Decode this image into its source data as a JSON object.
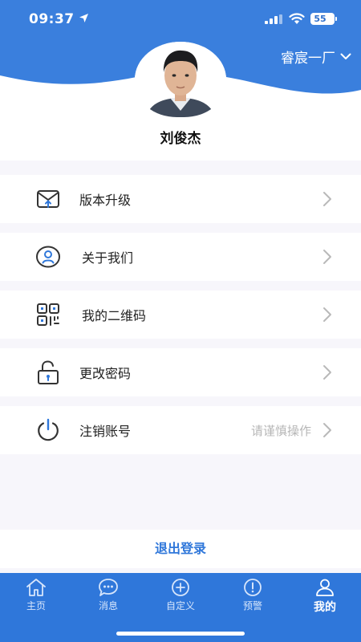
{
  "status": {
    "time": "09:37",
    "battery": "55"
  },
  "header": {
    "factory": "睿宸一厂",
    "username": "刘俊杰"
  },
  "menu": [
    {
      "icon": "upgrade-mail-icon",
      "label": "版本升级",
      "hint": ""
    },
    {
      "icon": "user-circle-icon",
      "label": "关于我们",
      "hint": ""
    },
    {
      "icon": "qr-code-icon",
      "label": "我的二维码",
      "hint": ""
    },
    {
      "icon": "lock-icon",
      "label": "更改密码",
      "hint": ""
    },
    {
      "icon": "power-icon",
      "label": "注销账号",
      "hint": "请谨慎操作"
    }
  ],
  "logout_label": "退出登录",
  "tabs": [
    {
      "icon": "home-icon",
      "label": "主页",
      "active": false
    },
    {
      "icon": "message-icon",
      "label": "消息",
      "active": false
    },
    {
      "icon": "add-circle-icon",
      "label": "自定义",
      "active": false
    },
    {
      "icon": "alert-icon",
      "label": "预警",
      "active": false
    },
    {
      "icon": "profile-icon",
      "label": "我的",
      "active": true
    }
  ],
  "colors": {
    "brand_blue": "#2f77da",
    "background": "#f7f6fb",
    "hint_gray": "#b7b7b7"
  }
}
